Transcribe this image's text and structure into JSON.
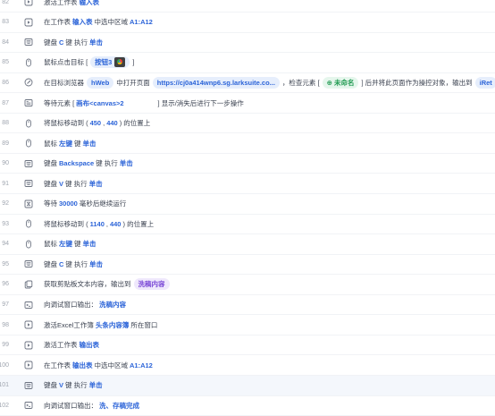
{
  "rows": [
    {
      "num": "82",
      "icon": "activate-sheet-icon",
      "parts": [
        {
          "type": "text",
          "v": "激活工作表"
        },
        {
          "type": "kw",
          "v": "输入表"
        }
      ]
    },
    {
      "num": "83",
      "icon": "activate-sheet-icon",
      "parts": [
        {
          "type": "text",
          "v": "在工作表"
        },
        {
          "type": "kw",
          "v": "输入表"
        },
        {
          "type": "text",
          "v": "中选中区域"
        },
        {
          "type": "kw",
          "v": "A1:A12"
        }
      ]
    },
    {
      "num": "84",
      "icon": "keyboard-icon",
      "parts": [
        {
          "type": "text",
          "v": "键盘"
        },
        {
          "type": "kw",
          "v": "C"
        },
        {
          "type": "text",
          "v": "键 执行"
        },
        {
          "type": "kw",
          "v": "单击"
        }
      ]
    },
    {
      "num": "85",
      "icon": "mouse-icon",
      "parts": [
        {
          "type": "text",
          "v": "鼠标点击目标 ["
        },
        {
          "type": "chip",
          "v": "按钮3"
        },
        {
          "type": "text",
          "v": "]"
        }
      ]
    },
    {
      "num": "86",
      "icon": "browser-icon",
      "parts": [
        {
          "type": "text",
          "v": "在目标浏览器"
        },
        {
          "type": "chip",
          "v": "hWeb"
        },
        {
          "type": "text",
          "v": "中打开页面"
        },
        {
          "type": "chip",
          "v": "https://cj0a414wnp6.sg.larksuite.co..."
        },
        {
          "type": "text",
          "v": "，检查元素 ["
        },
        {
          "type": "chip-green",
          "v": "⊕ 未命名"
        },
        {
          "type": "text",
          "v": "] 后并将此页面作为操控对象，输出到"
        },
        {
          "type": "chip",
          "v": "iRet"
        }
      ]
    },
    {
      "num": "87",
      "icon": "wait-element-icon",
      "parts": [
        {
          "type": "text",
          "v": "等待元素 ["
        },
        {
          "type": "kw",
          "v": "画布<canvas>2"
        },
        {
          "type": "blank",
          "v": ""
        },
        {
          "type": "text",
          "v": "] 显示/消失后进行下一步操作"
        }
      ]
    },
    {
      "num": "88",
      "icon": "mouse-icon",
      "parts": [
        {
          "type": "text",
          "v": "将鼠标移动到 ("
        },
        {
          "type": "kw",
          "v": "450"
        },
        {
          "type": "text",
          "v": ","
        },
        {
          "type": "kw",
          "v": "440"
        },
        {
          "type": "text",
          "v": ") 的位置上"
        }
      ]
    },
    {
      "num": "89",
      "icon": "mouse-icon",
      "parts": [
        {
          "type": "text",
          "v": "鼠标"
        },
        {
          "type": "kw",
          "v": "左键"
        },
        {
          "type": "text",
          "v": "键"
        },
        {
          "type": "kw",
          "v": "单击"
        }
      ]
    },
    {
      "num": "90",
      "icon": "keyboard-icon",
      "parts": [
        {
          "type": "text",
          "v": "键盘"
        },
        {
          "type": "kw",
          "v": "Backspace"
        },
        {
          "type": "text",
          "v": "键 执行"
        },
        {
          "type": "kw",
          "v": "单击"
        }
      ]
    },
    {
      "num": "91",
      "icon": "keyboard-icon",
      "parts": [
        {
          "type": "text",
          "v": "键盘"
        },
        {
          "type": "kw",
          "v": "V"
        },
        {
          "type": "text",
          "v": "键 执行"
        },
        {
          "type": "kw",
          "v": "单击"
        }
      ]
    },
    {
      "num": "92",
      "icon": "wait-icon",
      "parts": [
        {
          "type": "text",
          "v": "等待"
        },
        {
          "type": "kw",
          "v": "30000"
        },
        {
          "type": "text",
          "v": "毫秒后继续运行"
        }
      ]
    },
    {
      "num": "93",
      "icon": "mouse-icon",
      "parts": [
        {
          "type": "text",
          "v": "将鼠标移动到 ("
        },
        {
          "type": "kw",
          "v": "1140"
        },
        {
          "type": "text",
          "v": ","
        },
        {
          "type": "kw",
          "v": "440"
        },
        {
          "type": "text",
          "v": ") 的位置上"
        }
      ]
    },
    {
      "num": "94",
      "icon": "mouse-icon",
      "parts": [
        {
          "type": "text",
          "v": "鼠标"
        },
        {
          "type": "kw",
          "v": "左键"
        },
        {
          "type": "text",
          "v": "键"
        },
        {
          "type": "kw",
          "v": "单击"
        }
      ]
    },
    {
      "num": "95",
      "icon": "keyboard-icon",
      "parts": [
        {
          "type": "text",
          "v": "键盘"
        },
        {
          "type": "kw",
          "v": "C"
        },
        {
          "type": "text",
          "v": "键 执行"
        },
        {
          "type": "kw",
          "v": "单击"
        }
      ]
    },
    {
      "num": "96",
      "icon": "clipboard-icon",
      "parts": [
        {
          "type": "text",
          "v": "获取剪贴板文本内容，输出到"
        },
        {
          "type": "chip-purple",
          "v": "洗稿内容"
        }
      ]
    },
    {
      "num": "97",
      "icon": "debug-output-icon",
      "parts": [
        {
          "type": "text",
          "v": "向调试窗口输出："
        },
        {
          "type": "kw",
          "v": "洗稿内容"
        }
      ]
    },
    {
      "num": "98",
      "icon": "activate-sheet-icon",
      "parts": [
        {
          "type": "text",
          "v": "激活Excel工作簿"
        },
        {
          "type": "kw",
          "v": "头条内容簿"
        },
        {
          "type": "text",
          "v": "所在窗口"
        }
      ]
    },
    {
      "num": "99",
      "icon": "activate-sheet-icon",
      "parts": [
        {
          "type": "text",
          "v": "激活工作表"
        },
        {
          "type": "kw",
          "v": "输出表"
        }
      ]
    },
    {
      "num": "100",
      "icon": "activate-sheet-icon",
      "parts": [
        {
          "type": "text",
          "v": "在工作表"
        },
        {
          "type": "kw",
          "v": "输出表"
        },
        {
          "type": "text",
          "v": "中选中区域"
        },
        {
          "type": "kw",
          "v": "A1:A12"
        }
      ]
    },
    {
      "num": "101",
      "icon": "keyboard-icon",
      "parts": [
        {
          "type": "text",
          "v": "键盘"
        },
        {
          "type": "kw",
          "v": "V"
        },
        {
          "type": "text",
          "v": "键 执行"
        },
        {
          "type": "kw",
          "v": "单击"
        }
      ]
    },
    {
      "num": "102",
      "icon": "debug-output-icon",
      "parts": [
        {
          "type": "text",
          "v": "向调试窗口输出："
        },
        {
          "type": "kw",
          "v": "洗、存稿完成"
        }
      ]
    }
  ]
}
